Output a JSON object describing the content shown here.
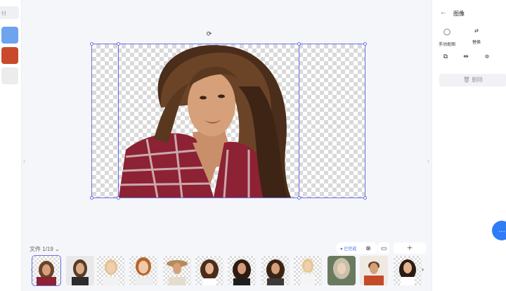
{
  "left_strip": {
    "input_fragment": "付",
    "swatches": [
      "#6ea3ee",
      "#c84a2a",
      "#ececec"
    ]
  },
  "canvas": {
    "rotate_icon": "rotate-icon",
    "image_alt": "cutout-portrait"
  },
  "filmstrip": {
    "file_label": "文件 1/19",
    "done_label": "已完成",
    "prev_icon": "‹",
    "next_icon": "›",
    "thumb_count": 12,
    "active_index": 0
  },
  "right_panel": {
    "title": "图像",
    "tools": [
      {
        "icon": "manual-cutout-icon",
        "label": "手动抠图"
      },
      {
        "icon": "replace-icon",
        "label": "替换"
      }
    ],
    "delete_label": "删除"
  },
  "colors": {
    "accent": "#6b6fe6",
    "fab": "#2f7cf6"
  }
}
